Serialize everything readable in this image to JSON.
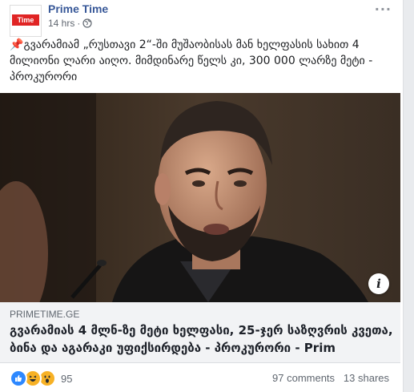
{
  "page": {
    "name": "Prime Time",
    "logo_text": "Time",
    "time": "14 hrs",
    "privacy_icon": "globe-icon",
    "more_label": "···"
  },
  "post": {
    "pin_icon": "📌",
    "text": "გვარამიამ „რუსთავი 2“-ში მუშაობისას მან ხელფასის სახით 4 მილიონი ლარი აიღო. მიმდინარე წელს კი, 300 000 ლარზე მეტი - პროკურორი"
  },
  "link_preview": {
    "domain": "PRIMETIME.GE",
    "title": "გვარამიას 4 მლნ-ზე მეტი ხელფასი, 25-ჯერ საზღვრის კვეთა, ბინა და აგარაკი უფიქსირდება - პროკურორი - Prim",
    "info_label": "i"
  },
  "engagement": {
    "reaction_count": "95",
    "comments": "97 comments",
    "shares": "13 shares",
    "reaction_icons": [
      "like-icon",
      "haha-icon",
      "wow-icon"
    ]
  },
  "colors": {
    "link_blue": "#385898",
    "meta_gray": "#606770",
    "like_blue": "#2d88ff",
    "logo_red": "#e02424"
  }
}
